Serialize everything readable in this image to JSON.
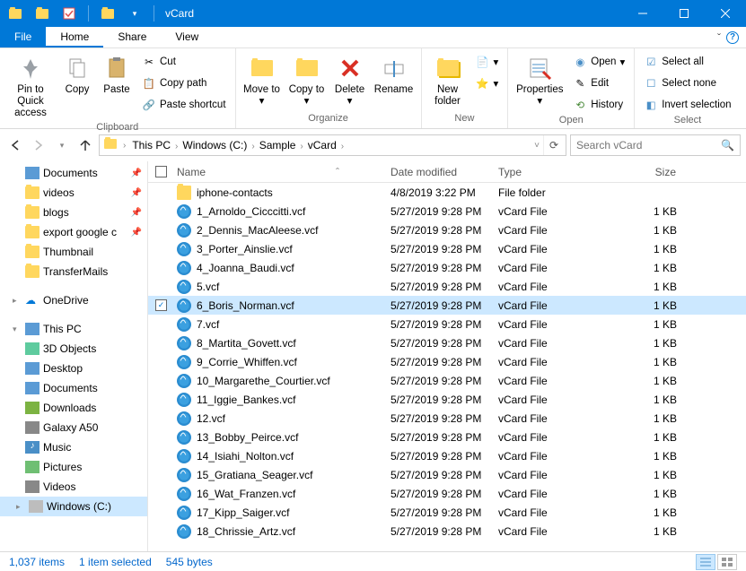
{
  "titlebar": {
    "title": "vCard"
  },
  "tabs": {
    "file": "File",
    "home": "Home",
    "share": "Share",
    "view": "View"
  },
  "ribbon": {
    "pin": "Pin to Quick access",
    "copy": "Copy",
    "paste": "Paste",
    "cut": "Cut",
    "copy_path": "Copy path",
    "paste_shortcut": "Paste shortcut",
    "clipboard_group": "Clipboard",
    "move_to": "Move to",
    "copy_to": "Copy to",
    "delete": "Delete",
    "rename": "Rename",
    "organize_group": "Organize",
    "new_folder": "New folder",
    "new_group": "New",
    "properties": "Properties",
    "open": "Open",
    "edit": "Edit",
    "history": "History",
    "open_group": "Open",
    "select_all": "Select all",
    "select_none": "Select none",
    "invert_selection": "Invert selection",
    "select_group": "Select"
  },
  "breadcrumb": {
    "parts": [
      "This PC",
      "Windows (C:)",
      "Sample",
      "vCard"
    ],
    "search_placeholder": "Search vCard"
  },
  "tree": {
    "top_items": [
      {
        "label": "Documents",
        "icon": "doc",
        "pinned": true
      },
      {
        "label": "videos",
        "icon": "folder",
        "pinned": true
      },
      {
        "label": "blogs",
        "icon": "folder",
        "pinned": true
      },
      {
        "label": "export google c",
        "icon": "folder",
        "pinned": true
      },
      {
        "label": "Thumbnail",
        "icon": "folder",
        "pinned": false
      },
      {
        "label": "TransferMails",
        "icon": "folder",
        "pinned": false
      }
    ],
    "onedrive": "OneDrive",
    "thispc": "This PC",
    "pc_items": [
      {
        "label": "3D Objects",
        "icon": "3d"
      },
      {
        "label": "Desktop",
        "icon": "desktop"
      },
      {
        "label": "Documents",
        "icon": "doc"
      },
      {
        "label": "Downloads",
        "icon": "downloads"
      },
      {
        "label": "Galaxy A50",
        "icon": "phone"
      },
      {
        "label": "Music",
        "icon": "music"
      },
      {
        "label": "Pictures",
        "icon": "pictures"
      },
      {
        "label": "Videos",
        "icon": "videos"
      },
      {
        "label": "Windows (C:)",
        "icon": "drive",
        "selected": true
      }
    ]
  },
  "columns": {
    "name": "Name",
    "date": "Date modified",
    "type": "Type",
    "size": "Size"
  },
  "files": [
    {
      "name": "iphone-contacts",
      "date": "4/8/2019 3:22 PM",
      "type": "File folder",
      "size": "",
      "icon": "folder",
      "selected": false
    },
    {
      "name": "1_Arnoldo_Cicccitti.vcf",
      "date": "5/27/2019 9:28 PM",
      "type": "vCard File",
      "size": "1 KB",
      "icon": "vcard",
      "selected": false
    },
    {
      "name": "2_Dennis_MacAleese.vcf",
      "date": "5/27/2019 9:28 PM",
      "type": "vCard File",
      "size": "1 KB",
      "icon": "vcard",
      "selected": false
    },
    {
      "name": "3_Porter_Ainslie.vcf",
      "date": "5/27/2019 9:28 PM",
      "type": "vCard File",
      "size": "1 KB",
      "icon": "vcard",
      "selected": false
    },
    {
      "name": "4_Joanna_Baudi.vcf",
      "date": "5/27/2019 9:28 PM",
      "type": "vCard File",
      "size": "1 KB",
      "icon": "vcard",
      "selected": false
    },
    {
      "name": "5.vcf",
      "date": "5/27/2019 9:28 PM",
      "type": "vCard File",
      "size": "1 KB",
      "icon": "vcard",
      "selected": false
    },
    {
      "name": "6_Boris_Norman.vcf",
      "date": "5/27/2019 9:28 PM",
      "type": "vCard File",
      "size": "1 KB",
      "icon": "vcard",
      "selected": true
    },
    {
      "name": "7.vcf",
      "date": "5/27/2019 9:28 PM",
      "type": "vCard File",
      "size": "1 KB",
      "icon": "vcard",
      "selected": false
    },
    {
      "name": "8_Martita_Govett.vcf",
      "date": "5/27/2019 9:28 PM",
      "type": "vCard File",
      "size": "1 KB",
      "icon": "vcard",
      "selected": false
    },
    {
      "name": "9_Corrie_Whiffen.vcf",
      "date": "5/27/2019 9:28 PM",
      "type": "vCard File",
      "size": "1 KB",
      "icon": "vcard",
      "selected": false
    },
    {
      "name": "10_Margarethe_Courtier.vcf",
      "date": "5/27/2019 9:28 PM",
      "type": "vCard File",
      "size": "1 KB",
      "icon": "vcard",
      "selected": false
    },
    {
      "name": "11_Iggie_Bankes.vcf",
      "date": "5/27/2019 9:28 PM",
      "type": "vCard File",
      "size": "1 KB",
      "icon": "vcard",
      "selected": false
    },
    {
      "name": "12.vcf",
      "date": "5/27/2019 9:28 PM",
      "type": "vCard File",
      "size": "1 KB",
      "icon": "vcard",
      "selected": false
    },
    {
      "name": "13_Bobby_Peirce.vcf",
      "date": "5/27/2019 9:28 PM",
      "type": "vCard File",
      "size": "1 KB",
      "icon": "vcard",
      "selected": false
    },
    {
      "name": "14_Isiahi_Nolton.vcf",
      "date": "5/27/2019 9:28 PM",
      "type": "vCard File",
      "size": "1 KB",
      "icon": "vcard",
      "selected": false
    },
    {
      "name": "15_Gratiana_Seager.vcf",
      "date": "5/27/2019 9:28 PM",
      "type": "vCard File",
      "size": "1 KB",
      "icon": "vcard",
      "selected": false
    },
    {
      "name": "16_Wat_Franzen.vcf",
      "date": "5/27/2019 9:28 PM",
      "type": "vCard File",
      "size": "1 KB",
      "icon": "vcard",
      "selected": false
    },
    {
      "name": "17_Kipp_Saiger.vcf",
      "date": "5/27/2019 9:28 PM",
      "type": "vCard File",
      "size": "1 KB",
      "icon": "vcard",
      "selected": false
    },
    {
      "name": "18_Chrissie_Artz.vcf",
      "date": "5/27/2019 9:28 PM",
      "type": "vCard File",
      "size": "1 KB",
      "icon": "vcard",
      "selected": false
    }
  ],
  "status": {
    "items": "1,037 items",
    "selected": "1 item selected",
    "size": "545 bytes"
  }
}
